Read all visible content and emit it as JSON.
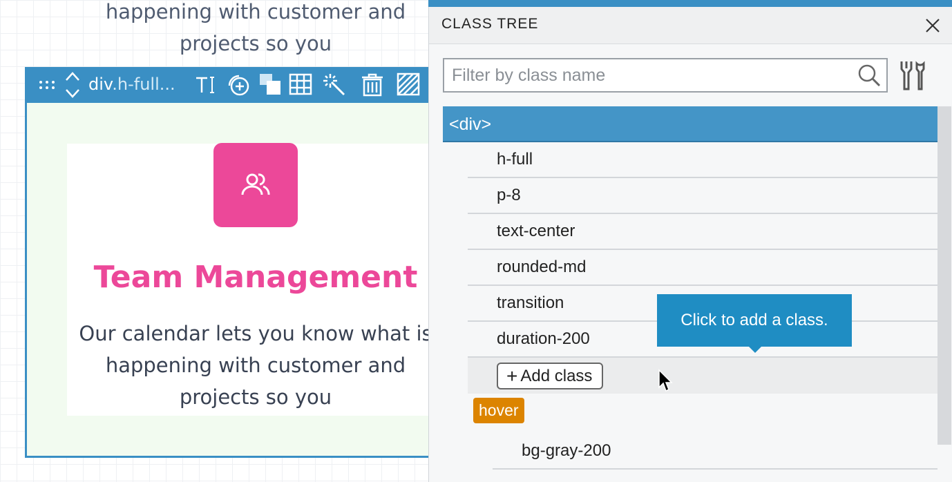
{
  "canvas": {
    "top_text": [
      "happening with customer and",
      "projects so you"
    ],
    "toolbar": {
      "element_tag": "div",
      "element_class": ".h-full..."
    },
    "card": {
      "title": "Team Management",
      "body": [
        "Our calendar lets you know what is",
        "happening with customer and",
        "projects so you"
      ],
      "icon": "users-icon",
      "icon_color": "#ec4899",
      "title_color": "#ec4899"
    }
  },
  "panel": {
    "title": "CLASS TREE",
    "filter_placeholder": "Filter by class name",
    "root": "<div>",
    "classes": [
      "h-full",
      "p-8",
      "text-center",
      "rounded-md",
      "transition",
      "duration-200"
    ],
    "add_class_label": "Add class",
    "tooltip": "Click to add a class.",
    "state_badge": "hover",
    "state_badge_color": "#dc8400",
    "hover_classes": [
      "bg-gray-200"
    ],
    "accent_color": "#3a8fc4"
  }
}
